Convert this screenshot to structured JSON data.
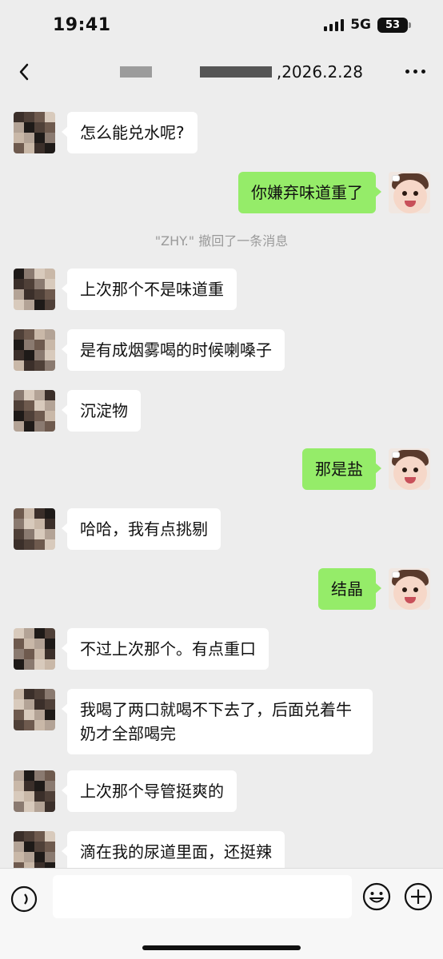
{
  "status": {
    "time": "19:41",
    "network": "5G",
    "battery": "53"
  },
  "nav": {
    "title_suffix": ",2026.2.28"
  },
  "messages": [
    {
      "side": "left",
      "text": "怎么能兑水呢?"
    },
    {
      "side": "right",
      "text": "你嫌弃味道重了"
    },
    {
      "side": "system",
      "text": "\"ZHY.\" 撤回了一条消息"
    },
    {
      "side": "left",
      "text": "上次那个不是味道重"
    },
    {
      "side": "left",
      "text": "是有成烟雾喝的时候喇嗓子"
    },
    {
      "side": "left",
      "text": "沉淀物"
    },
    {
      "side": "right",
      "text": "那是盐"
    },
    {
      "side": "left",
      "text": "哈哈，我有点挑剔"
    },
    {
      "side": "right",
      "text": "结晶"
    },
    {
      "side": "left",
      "text": "不过上次那个。有点重口"
    },
    {
      "side": "left",
      "text": "我喝了两口就喝不下去了，后面兑着牛奶才全部喝完"
    },
    {
      "side": "left",
      "text": "上次那个导管挺爽的"
    },
    {
      "side": "left",
      "text": "滴在我的尿道里面，还挺辣"
    }
  ],
  "input": {
    "placeholder": ""
  },
  "colors": {
    "background": "#ededed",
    "self_bubble": "#95ec69",
    "other_bubble": "#ffffff",
    "system_text": "#9a9a9a"
  },
  "icons": [
    "back-icon",
    "more-icon",
    "voice-icon",
    "emoji-icon",
    "plus-icon"
  ]
}
